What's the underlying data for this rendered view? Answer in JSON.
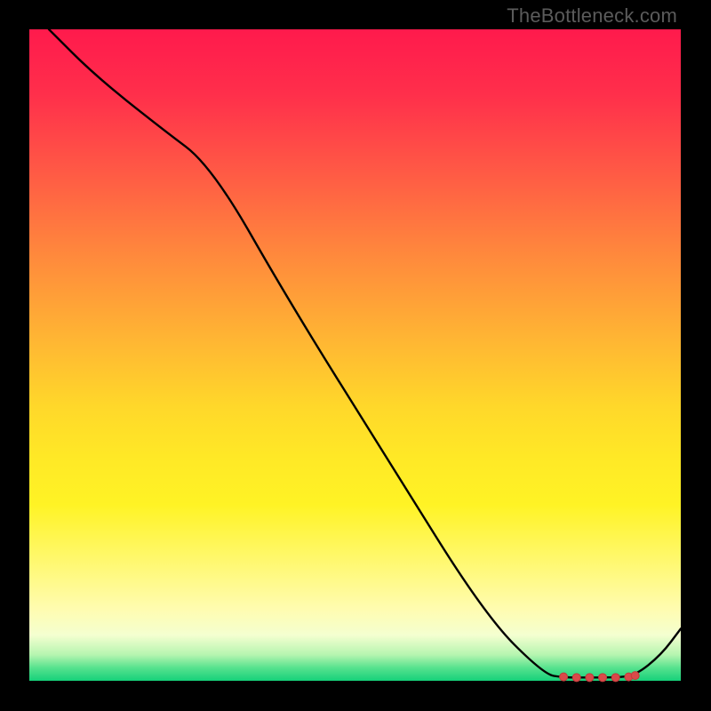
{
  "watermark": "TheBottleneck.com",
  "chart_data": {
    "type": "line",
    "title": "",
    "xlabel": "",
    "ylabel": "",
    "xlim": [
      0,
      100
    ],
    "ylim": [
      0,
      100
    ],
    "grid": false,
    "legend": false,
    "series": [
      {
        "name": "curve",
        "x": [
          3,
          10,
          20,
          28,
          40,
          55,
          70,
          79,
          82,
          86,
          90,
          93,
          97,
          100
        ],
        "y": [
          100,
          93,
          85,
          79,
          58,
          34,
          10,
          1,
          0.5,
          0.5,
          0.5,
          0.8,
          4,
          8
        ]
      }
    ],
    "markers": {
      "name": "flat-segment-dots",
      "x": [
        82,
        84,
        86,
        88,
        90,
        92,
        93
      ],
      "y": [
        0.6,
        0.5,
        0.5,
        0.5,
        0.5,
        0.6,
        0.8
      ]
    },
    "background_gradient": {
      "top": "#ff1a4c",
      "mid": "#ffe926",
      "bottom": "#16d17a"
    }
  }
}
